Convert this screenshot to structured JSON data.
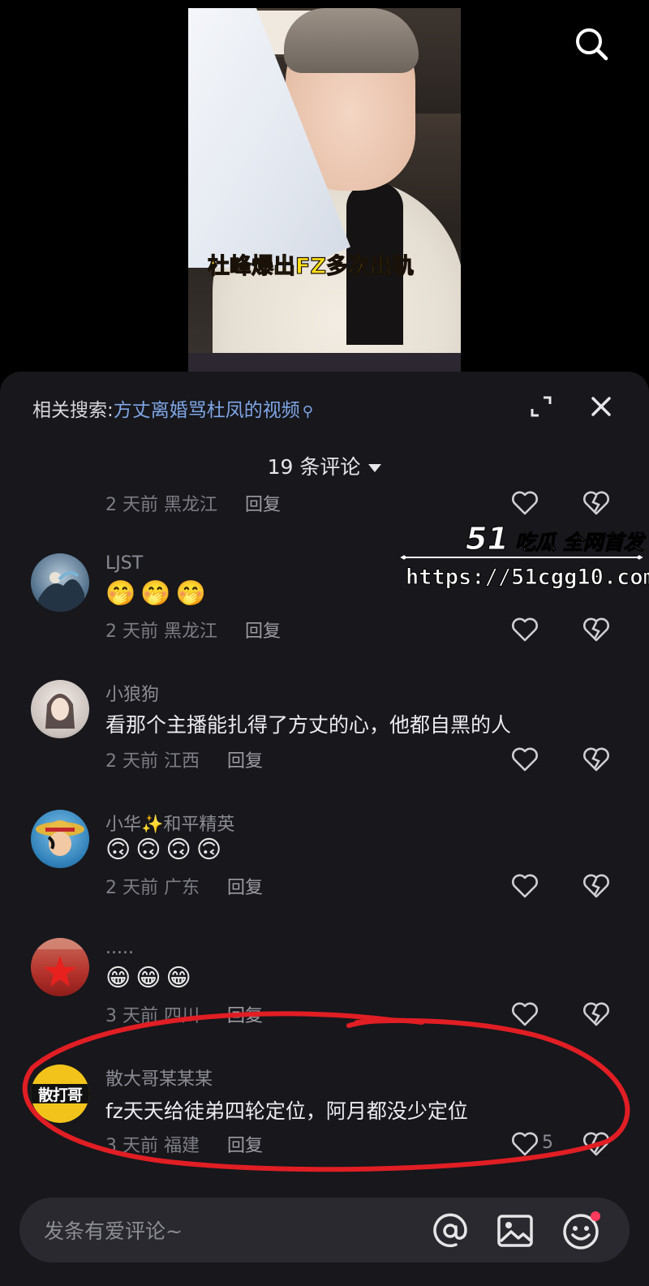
{
  "video": {
    "caption": "杜峰爆出FZ多次出轨"
  },
  "panel": {
    "related_label": "相关搜索:",
    "related_query": "方丈离婚骂杜凤的视频",
    "comment_count": "19 条评论"
  },
  "comments": [
    {
      "time_location": "2 天前  黑龙江",
      "reply": "回复"
    },
    {
      "name": "LJST",
      "emoji": "🤭🤭🤭",
      "time_location": "2 天前  黑龙江",
      "reply": "回复"
    },
    {
      "name": "小狼狗",
      "text": "看那个主播能扎得了方丈的心，他都自黑的人",
      "time_location": "2 天前  江西",
      "reply": "回复"
    },
    {
      "name": "小华✨和平精英",
      "emoji": "🙃🙃🙃🙃",
      "time_location": "2 天前  广东",
      "reply": "回复"
    },
    {
      "name": ".....",
      "emoji": "😁😁😁",
      "time_location": "3 天前  四川",
      "reply": "回复"
    },
    {
      "name": "散大哥某某某",
      "text": "fz天天给徒弟四轮定位，阿月都没少定位",
      "time_location": "3 天前  福建",
      "reply": "回复",
      "likes": "5",
      "avatar_text": "散打哥"
    }
  ],
  "watermark": {
    "brand": "51",
    "brand_tag": "吃瓜 全网首发",
    "url": "https://51cgg10.com"
  },
  "input": {
    "placeholder": "发条有爱评论~"
  },
  "colors": {
    "panel": "#17171c",
    "accent_link": "#7fa6e6",
    "annotation": "#e01e24",
    "caption": "#ffe11a"
  }
}
